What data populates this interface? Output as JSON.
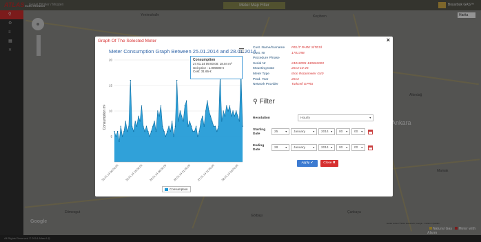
{
  "header": {
    "logo": "ATLAS",
    "logo_sub": "ELECTRONICS",
    "app_name": "Genel Bilgiler / Müşteri",
    "map_title": "Meter Map Filter",
    "user": "Boyarbuk GAS™"
  },
  "sidebar": {
    "items": [
      {
        "icon": "map-pin-icon",
        "glyph": "⚲"
      },
      {
        "icon": "gear-icon",
        "glyph": "⚙"
      },
      {
        "icon": "list-icon",
        "glyph": "≡"
      },
      {
        "icon": "chart-icon",
        "glyph": "▦"
      },
      {
        "icon": "tools-icon",
        "glyph": "✕"
      }
    ]
  },
  "map": {
    "city": "Ankara",
    "layer_select": "Harita",
    "legend": [
      {
        "label": "Natural Gas",
        "color": "#e8c33a"
      },
      {
        "label": "Meter with Alarm",
        "color": "#d62f2f"
      }
    ],
    "labels": [
      "Yenimahalle",
      "Etimesgut",
      "Keçiören",
      "Altındağ",
      "Çankaya",
      "Mamak",
      "Gölbaşı"
    ],
    "footer_small": "Harita verileri ©2014 Basarsoft, Google · Kullanım Şartları"
  },
  "footer": "All Rights Reserved © 2014 Atlas A.Ş.",
  "modal": {
    "title": "Graph Of The Selected Meter",
    "close_label": "×",
    "chart_title": "Meter Consumption Graph Between 25.01.2014 and 28.01.2014",
    "tooltip": {
      "title": "Consumption",
      "line1": "27.01.14 09:00:00: 18.04 m³",
      "line2": "Unit price : 1.000000 €",
      "line3": "Cost: 31.65 €"
    },
    "info": [
      {
        "label": "Cust. Name/Surname",
        "value": "PELİT PARK SİTESİ"
      },
      {
        "label": "Cust. Nr",
        "value": "1701788"
      },
      {
        "label": "Procedure Phrase",
        "value": ""
      },
      {
        "label": "Serial Nr",
        "value": "24010095-130822003"
      },
      {
        "label": "Mounting Date",
        "value": "2013-10-25"
      },
      {
        "label": "Meter Type",
        "value": "Itron Rotarimeter G40"
      },
      {
        "label": "Prod. Year",
        "value": "2013"
      },
      {
        "label": "Network Provider",
        "value": "Turkcell GPRS"
      }
    ],
    "filter": {
      "heading": "Filter",
      "resolution_label": "Resolution",
      "resolution_value": "Hourly",
      "starting_label": "Starting Date",
      "starting": {
        "day": "25",
        "month": "January",
        "year": "2014",
        "hour": "00",
        "minute": "00"
      },
      "ending_label": "Ending Date",
      "ending": {
        "day": "28",
        "month": "January",
        "year": "2014",
        "hour": "00",
        "minute": "00"
      },
      "apply_label": "Apply ✔",
      "close_label": "Close ✖"
    }
  },
  "chart_data": {
    "type": "area",
    "title": "Meter Consumption Graph Between 25.01.2014 and 28.01.2014",
    "ylabel": "Consumption m³",
    "xlabel": "",
    "ylim": [
      0,
      20
    ],
    "yticks": [
      5,
      10,
      15,
      20
    ],
    "xticks": [
      "25.01.14 00:00:00",
      "25.01.14 15:00:00",
      "26.01.14 06:00:00",
      "26.01.14 21:00:00",
      "27.01.14 12:00:00",
      "28.01.14 03:00:00"
    ],
    "legend": [
      "Consumption"
    ],
    "color": "#1a97d5",
    "values": [
      6,
      5,
      6,
      4,
      7,
      5,
      6,
      8,
      6,
      7,
      16,
      7,
      6,
      8,
      7,
      9,
      8,
      11,
      7,
      6,
      7,
      6,
      5,
      6,
      7,
      8,
      6,
      10,
      9,
      11,
      7,
      6,
      5,
      6,
      7,
      6,
      8,
      5,
      7,
      16,
      8,
      10,
      9,
      8,
      11,
      12,
      7,
      8,
      7,
      6,
      6,
      7,
      5,
      6,
      8,
      9,
      7,
      10,
      12,
      10,
      9,
      8,
      7,
      7,
      6,
      7,
      17,
      8,
      10,
      9,
      11,
      10,
      11,
      9,
      10,
      9,
      10,
      9,
      8,
      18,
      7
    ]
  }
}
